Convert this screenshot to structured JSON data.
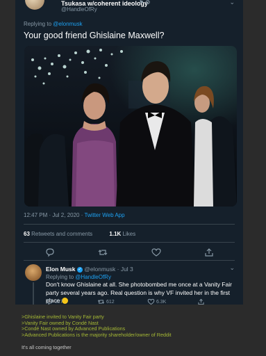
{
  "author": {
    "display_name": "Tsukasa w/coherent ideology",
    "handle": "@HandleOfRy",
    "badges": "⚑ ❂"
  },
  "tweet": {
    "replying_prefix": "Replying to",
    "replying_to": "@elonmusk",
    "text": "Your good friend Ghislaine Maxwell?",
    "time": "12:47 PM · Jul 2, 2020 ·",
    "client": "Twitter Web App",
    "retweets_count": "63",
    "retweets_label": "Retweets and comments",
    "likes_count": "1.1K",
    "likes_label": "Likes"
  },
  "reply": {
    "name": "Elon Musk",
    "handle_date": "@elonmusk · Jul 3",
    "replying_prefix": "Replying to",
    "replying_to": "@HandleOfRy",
    "text": "Don't know Ghislaine at all. She photobombed me once at a Vanity Fair party several years ago. Real question is why VF invited her in the first place",
    "replies": "327",
    "retweets": "612",
    "likes": "6.3K"
  },
  "comment_lines": [
    ">Ghislaine invited to Vanity Fair party",
    ">Vanity Fair owned by Condé Nast",
    ">Condé Nast owned by Advanced Publications",
    ">Advanced Publications is the majority shareholder/owner of Reddit"
  ],
  "comment_footer": "It's all coming together",
  "colors": {
    "card_bg": "#15202b",
    "page_bg": "#2b2b2b",
    "accent": "#1da1f2",
    "greentext": "#a5b835"
  }
}
